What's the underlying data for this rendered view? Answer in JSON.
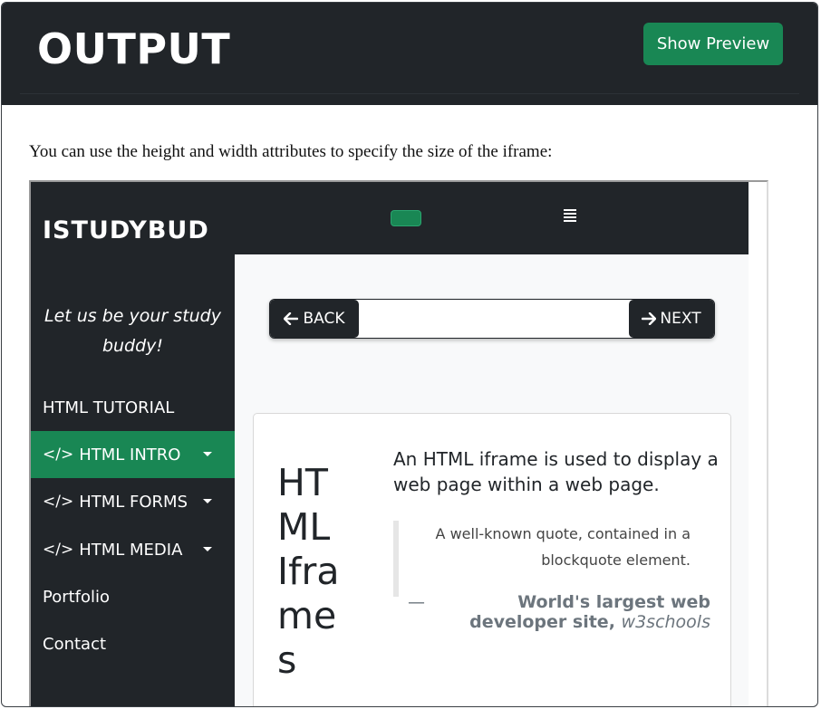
{
  "header": {
    "title": "OUTPUT",
    "preview_button": "Show Preview"
  },
  "intro": "You can use the height and width attributes to specify the size of the iframe:",
  "site": {
    "brand": "ISTUDYBUD",
    "tagline_line1": "Let us be your study",
    "tagline_line2": "buddy!",
    "nav": [
      {
        "label": "HTML TUTORIAL",
        "icon": "",
        "dropdown": false
      },
      {
        "label": "HTML INTRO",
        "icon": "</>",
        "dropdown": true,
        "active": true
      },
      {
        "label": "HTML FORMS",
        "icon": "</>",
        "dropdown": true
      },
      {
        "label": "HTML MEDIA",
        "icon": "</>",
        "dropdown": true
      },
      {
        "label": "Portfolio",
        "icon": "",
        "dropdown": false
      },
      {
        "label": "Contact",
        "icon": "",
        "dropdown": false
      }
    ],
    "pager": {
      "back_label": "BACK",
      "next_label": "NEXT",
      "back_icon": "arrow-left-icon",
      "next_icon": "arrow-right-icon"
    },
    "card": {
      "heading": "HTML Iframes",
      "lead": "An HTML iframe is used to display a web page within a web page.",
      "quote": "A well-known quote, contained in a blockquote element.",
      "quote_source_dash": "—",
      "quote_source_text": "World's largest web developer site,",
      "quote_source_cite": "w3schools"
    }
  },
  "colors": {
    "dark": "#212529",
    "accent": "#198754",
    "muted": "#6c757d"
  }
}
